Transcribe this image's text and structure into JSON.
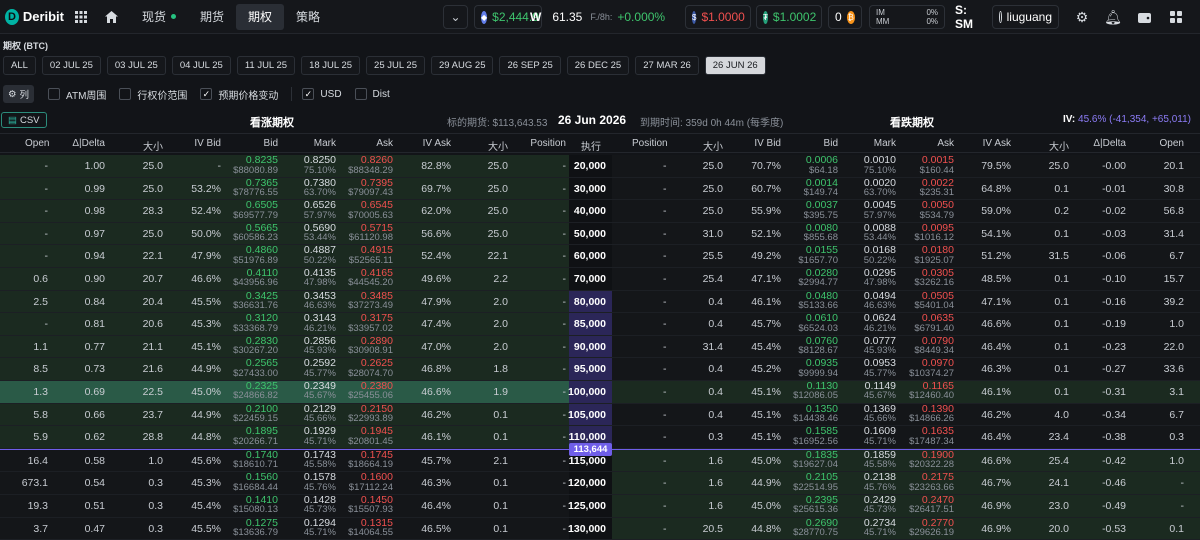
{
  "topbar": {
    "logo": "Deribit",
    "nav": [
      "现货",
      "期货",
      "期权",
      "策略"
    ],
    "btc_price": "$2,444.9",
    "index_value": "61.35",
    "funding_label": "F./8h:",
    "funding_value": "+0.000%",
    "bal_red": "$1.0000",
    "bal_green": "$1.0002",
    "counter": "0",
    "im_label": "IM",
    "im_value": "0%",
    "mm_label": "MM",
    "mm_value": "0%",
    "sm": "S: SM",
    "user": "liuguang"
  },
  "page_title": "期权 (BTC)",
  "expiries": [
    "ALL",
    "02 JUL 25",
    "03 JUL 25",
    "04 JUL 25",
    "11 JUL 25",
    "18 JUL 25",
    "25 JUL 25",
    "29 AUG 25",
    "26 SEP 25",
    "26 DEC 25",
    "27 MAR 26",
    "26 JUN 26"
  ],
  "options_bar": {
    "columns_btn": "列",
    "atm": "ATM周围",
    "strike_range": "行权价范围",
    "price_change": "预期价格变动",
    "usd": "USD",
    "dist": "Dist"
  },
  "header": {
    "csv": "CSV",
    "calls": "看涨期权",
    "underlying": "标的期货: $113,643.53",
    "date": "26 Jun 2026",
    "expiry": "到期时间: 359d 0h 44m (每季度)",
    "puts": "看跌期权",
    "iv_label": "IV:",
    "iv_value": "45.6% (-41,354, +65,011)"
  },
  "columns": {
    "open": "Open",
    "delta": "Δ|Delta",
    "size": "大小",
    "ivbid": "IV Bid",
    "bid": "Bid",
    "mark": "Mark",
    "ask": "Ask",
    "ivask": "IV Ask",
    "size2": "大小",
    "position": "Position",
    "strike": "执行"
  },
  "atm_price": "113,644",
  "rows": [
    {
      "strike": "20,000",
      "c": {
        "open": "-",
        "delta": "1.00",
        "size": "25.0",
        "ivbid": "-",
        "bid": "0.8235",
        "bidu": "$88080.89",
        "mark": "0.8250",
        "marku": "75.10%",
        "ask": "0.8260",
        "asku": "$88348.29",
        "ivask": "82.8%",
        "size2": "25.0",
        "pos": "-"
      },
      "p": {
        "pos": "-",
        "size": "25.0",
        "ivbid": "70.7%",
        "bid": "0.0006",
        "bidu": "$64.18",
        "mark": "0.0010",
        "marku": "75.10%",
        "ask": "0.0015",
        "asku": "$160.44",
        "ivask": "79.5%",
        "size2": "25.0",
        "delta": "-0.00",
        "open": "20.1"
      }
    },
    {
      "strike": "30,000",
      "c": {
        "open": "-",
        "delta": "0.99",
        "size": "25.0",
        "ivbid": "53.2%",
        "bid": "0.7365",
        "bidu": "$78776.55",
        "mark": "0.7380",
        "marku": "63.70%",
        "ask": "0.7395",
        "asku": "$79097.43",
        "ivask": "69.7%",
        "size2": "25.0",
        "pos": "-"
      },
      "p": {
        "pos": "-",
        "size": "25.0",
        "ivbid": "60.7%",
        "bid": "0.0014",
        "bidu": "$149.74",
        "mark": "0.0020",
        "marku": "63.70%",
        "ask": "0.0022",
        "asku": "$235.31",
        "ivask": "64.8%",
        "size2": "0.1",
        "delta": "-0.01",
        "open": "30.8"
      }
    },
    {
      "strike": "40,000",
      "c": {
        "open": "-",
        "delta": "0.98",
        "size": "28.3",
        "ivbid": "52.4%",
        "bid": "0.6505",
        "bidu": "$69577.79",
        "mark": "0.6526",
        "marku": "57.97%",
        "ask": "0.6545",
        "asku": "$70005.63",
        "ivask": "62.0%",
        "size2": "25.0",
        "pos": "-"
      },
      "p": {
        "pos": "-",
        "size": "25.0",
        "ivbid": "55.9%",
        "bid": "0.0037",
        "bidu": "$395.75",
        "mark": "0.0045",
        "marku": "57.97%",
        "ask": "0.0050",
        "asku": "$534.79",
        "ivask": "59.0%",
        "size2": "0.2",
        "delta": "-0.02",
        "open": "56.8"
      }
    },
    {
      "strike": "50,000",
      "c": {
        "open": "-",
        "delta": "0.97",
        "size": "25.0",
        "ivbid": "50.0%",
        "bid": "0.5665",
        "bidu": "$60586.23",
        "mark": "0.5690",
        "marku": "53.44%",
        "ask": "0.5715",
        "asku": "$61120.98",
        "ivask": "56.6%",
        "size2": "25.0",
        "pos": "-"
      },
      "p": {
        "pos": "-",
        "size": "31.0",
        "ivbid": "52.1%",
        "bid": "0.0080",
        "bidu": "$855.68",
        "mark": "0.0088",
        "marku": "53.44%",
        "ask": "0.0095",
        "asku": "$1016.12",
        "ivask": "54.1%",
        "size2": "0.1",
        "delta": "-0.03",
        "open": "31.4"
      }
    },
    {
      "strike": "60,000",
      "c": {
        "open": "-",
        "delta": "0.94",
        "size": "22.1",
        "ivbid": "47.9%",
        "bid": "0.4860",
        "bidu": "$51976.89",
        "mark": "0.4887",
        "marku": "50.22%",
        "ask": "0.4915",
        "asku": "$52565.11",
        "ivask": "52.4%",
        "size2": "22.1",
        "pos": "-"
      },
      "p": {
        "pos": "-",
        "size": "25.5",
        "ivbid": "49.2%",
        "bid": "0.0155",
        "bidu": "$1657.70",
        "mark": "0.0168",
        "marku": "50.22%",
        "ask": "0.0180",
        "asku": "$1925.07",
        "ivask": "51.2%",
        "size2": "31.5",
        "delta": "-0.06",
        "open": "6.7"
      }
    },
    {
      "strike": "70,000",
      "c": {
        "open": "0.6",
        "delta": "0.90",
        "size": "20.7",
        "ivbid": "46.6%",
        "bid": "0.4110",
        "bidu": "$43956.96",
        "mark": "0.4135",
        "marku": "47.98%",
        "ask": "0.4165",
        "asku": "$44545.20",
        "ivask": "49.6%",
        "size2": "2.2",
        "pos": "-"
      },
      "p": {
        "pos": "-",
        "size": "25.4",
        "ivbid": "47.1%",
        "bid": "0.0280",
        "bidu": "$2994.77",
        "mark": "0.0295",
        "marku": "47.98%",
        "ask": "0.0305",
        "asku": "$3262.16",
        "ivask": "48.5%",
        "size2": "0.1",
        "delta": "-0.10",
        "open": "15.7"
      }
    },
    {
      "strike": "80,000",
      "c": {
        "open": "2.5",
        "delta": "0.84",
        "size": "20.4",
        "ivbid": "45.5%",
        "bid": "0.3425",
        "bidu": "$36631.76",
        "mark": "0.3453",
        "marku": "46.63%",
        "ask": "0.3485",
        "asku": "$37273.49",
        "ivask": "47.9%",
        "size2": "2.0",
        "pos": "-"
      },
      "p": {
        "pos": "-",
        "size": "0.4",
        "ivbid": "46.1%",
        "bid": "0.0480",
        "bidu": "$5133.66",
        "mark": "0.0494",
        "marku": "46.63%",
        "ask": "0.0505",
        "asku": "$5401.04",
        "ivask": "47.1%",
        "size2": "0.1",
        "delta": "-0.16",
        "open": "39.2"
      }
    },
    {
      "strike": "85,000",
      "c": {
        "open": "-",
        "delta": "0.81",
        "size": "20.6",
        "ivbid": "45.3%",
        "bid": "0.3120",
        "bidu": "$33368.79",
        "mark": "0.3143",
        "marku": "46.21%",
        "ask": "0.3175",
        "asku": "$33957.02",
        "ivask": "47.4%",
        "size2": "2.0",
        "pos": "-"
      },
      "p": {
        "pos": "-",
        "size": "0.4",
        "ivbid": "45.7%",
        "bid": "0.0610",
        "bidu": "$6524.03",
        "mark": "0.0624",
        "marku": "46.21%",
        "ask": "0.0635",
        "asku": "$6791.40",
        "ivask": "46.6%",
        "size2": "0.1",
        "delta": "-0.19",
        "open": "1.0"
      }
    },
    {
      "strike": "90,000",
      "c": {
        "open": "1.1",
        "delta": "0.77",
        "size": "21.1",
        "ivbid": "45.1%",
        "bid": "0.2830",
        "bidu": "$30267.20",
        "mark": "0.2856",
        "marku": "45.93%",
        "ask": "0.2890",
        "asku": "$30908.91",
        "ivask": "47.0%",
        "size2": "2.0",
        "pos": "-"
      },
      "p": {
        "pos": "-",
        "size": "31.4",
        "ivbid": "45.4%",
        "bid": "0.0760",
        "bidu": "$8128.67",
        "mark": "0.0777",
        "marku": "45.93%",
        "ask": "0.0790",
        "asku": "$8449.34",
        "ivask": "46.4%",
        "size2": "0.1",
        "delta": "-0.23",
        "open": "22.0"
      }
    },
    {
      "strike": "95,000",
      "c": {
        "open": "8.5",
        "delta": "0.73",
        "size": "21.6",
        "ivbid": "44.9%",
        "bid": "0.2565",
        "bidu": "$27433.00",
        "mark": "0.2592",
        "marku": "45.77%",
        "ask": "0.2625",
        "asku": "$28074.70",
        "ivask": "46.8%",
        "size2": "1.8",
        "pos": "-"
      },
      "p": {
        "pos": "-",
        "size": "0.4",
        "ivbid": "45.2%",
        "bid": "0.0935",
        "bidu": "$9999.94",
        "mark": "0.0953",
        "marku": "45.77%",
        "ask": "0.0970",
        "asku": "$10374.27",
        "ivask": "46.3%",
        "size2": "0.1",
        "delta": "-0.27",
        "open": "33.6"
      }
    },
    {
      "strike": "100,000",
      "c": {
        "open": "1.3",
        "delta": "0.69",
        "size": "22.5",
        "ivbid": "45.0%",
        "bid": "0.2325",
        "bidu": "$24866.82",
        "mark": "0.2349",
        "marku": "45.67%",
        "ask": "0.2380",
        "asku": "$25455.06",
        "ivask": "46.6%",
        "size2": "1.9",
        "pos": "-"
      },
      "p": {
        "pos": "-",
        "size": "0.4",
        "ivbid": "45.1%",
        "bid": "0.1130",
        "bidu": "$12086.05",
        "mark": "0.1149",
        "marku": "45.67%",
        "ask": "0.1165",
        "asku": "$12460.40",
        "ivask": "46.1%",
        "size2": "0.1",
        "delta": "-0.31",
        "open": "3.1"
      }
    },
    {
      "strike": "105,000",
      "c": {
        "open": "5.8",
        "delta": "0.66",
        "size": "23.7",
        "ivbid": "44.9%",
        "bid": "0.2100",
        "bidu": "$22459.15",
        "mark": "0.2129",
        "marku": "45.66%",
        "ask": "0.2150",
        "asku": "$22993.89",
        "ivask": "46.2%",
        "size2": "0.1",
        "pos": "-"
      },
      "p": {
        "pos": "-",
        "size": "0.4",
        "ivbid": "45.1%",
        "bid": "0.1350",
        "bidu": "$14438.46",
        "mark": "0.1369",
        "marku": "45.66%",
        "ask": "0.1390",
        "asku": "$14866.26",
        "ivask": "46.2%",
        "size2": "4.0",
        "delta": "-0.34",
        "open": "6.7"
      }
    },
    {
      "strike": "110,000",
      "c": {
        "open": "5.9",
        "delta": "0.62",
        "size": "28.8",
        "ivbid": "44.8%",
        "bid": "0.1895",
        "bidu": "$20266.71",
        "mark": "0.1929",
        "marku": "45.71%",
        "ask": "0.1945",
        "asku": "$20801.45",
        "ivask": "46.1%",
        "size2": "0.1",
        "pos": "-"
      },
      "p": {
        "pos": "-",
        "size": "0.3",
        "ivbid": "45.1%",
        "bid": "0.1585",
        "bidu": "$16952.56",
        "mark": "0.1609",
        "marku": "45.71%",
        "ask": "0.1635",
        "asku": "$17487.34",
        "ivask": "46.4%",
        "size2": "23.4",
        "delta": "-0.38",
        "open": "0.3"
      }
    },
    {
      "strike": "115,000",
      "c": {
        "open": "16.4",
        "delta": "0.58",
        "size": "1.0",
        "ivbid": "45.6%",
        "bid": "0.1740",
        "bidu": "$18610.71",
        "mark": "0.1743",
        "marku": "45.58%",
        "ask": "0.1745",
        "asku": "$18664.19",
        "ivask": "45.7%",
        "size2": "2.1",
        "pos": "-"
      },
      "p": {
        "pos": "-",
        "size": "1.6",
        "ivbid": "45.0%",
        "bid": "0.1835",
        "bidu": "$19627.04",
        "mark": "0.1859",
        "marku": "45.58%",
        "ask": "0.1900",
        "asku": "$20322.28",
        "ivask": "46.6%",
        "size2": "25.4",
        "delta": "-0.42",
        "open": "1.0"
      }
    },
    {
      "strike": "120,000",
      "c": {
        "open": "673.1",
        "delta": "0.54",
        "size": "0.3",
        "ivbid": "45.3%",
        "bid": "0.1560",
        "bidu": "$16684.44",
        "mark": "0.1578",
        "marku": "45.76%",
        "ask": "0.1600",
        "asku": "$17112.24",
        "ivask": "46.3%",
        "size2": "0.1",
        "pos": "-"
      },
      "p": {
        "pos": "-",
        "size": "1.6",
        "ivbid": "44.9%",
        "bid": "0.2105",
        "bidu": "$22514.95",
        "mark": "0.2138",
        "marku": "45.76%",
        "ask": "0.2175",
        "asku": "$23263.66",
        "ivask": "46.7%",
        "size2": "24.1",
        "delta": "-0.46",
        "open": "-"
      }
    },
    {
      "strike": "125,000",
      "c": {
        "open": "19.3",
        "delta": "0.51",
        "size": "0.3",
        "ivbid": "45.4%",
        "bid": "0.1410",
        "bidu": "$15080.13",
        "mark": "0.1428",
        "marku": "45.73%",
        "ask": "0.1450",
        "asku": "$15507.93",
        "ivask": "46.4%",
        "size2": "0.1",
        "pos": "-"
      },
      "p": {
        "pos": "-",
        "size": "1.6",
        "ivbid": "45.0%",
        "bid": "0.2395",
        "bidu": "$25615.36",
        "mark": "0.2429",
        "marku": "45.73%",
        "ask": "0.2470",
        "asku": "$26417.51",
        "ivask": "46.9%",
        "size2": "23.0",
        "delta": "-0.49",
        "open": "-"
      }
    },
    {
      "strike": "130,000",
      "c": {
        "open": "3.7",
        "delta": "0.47",
        "size": "0.3",
        "ivbid": "45.5%",
        "bid": "0.1275",
        "bidu": "$13636.79",
        "mark": "0.1294",
        "marku": "45.71%",
        "ask": "0.1315",
        "asku": "$14064.55",
        "ivask": "46.5%",
        "size2": "0.1",
        "pos": "-"
      },
      "p": {
        "pos": "-",
        "size": "20.5",
        "ivbid": "44.8%",
        "bid": "0.2690",
        "bidu": "$28770.75",
        "mark": "0.2734",
        "marku": "45.71%",
        "ask": "0.2770",
        "asku": "$29626.19",
        "ivask": "46.9%",
        "size2": "20.0",
        "delta": "-0.53",
        "open": "0.1"
      }
    }
  ]
}
